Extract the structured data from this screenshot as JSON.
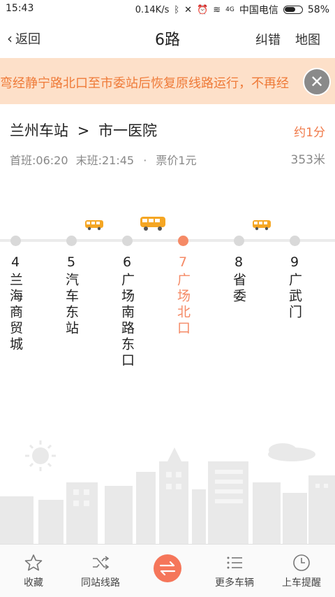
{
  "status_bar": {
    "time": "15:43",
    "speed": "0.14K/s",
    "network_badge": "4G",
    "carrier": "中国电信",
    "battery": "58%"
  },
  "header": {
    "back_label": "返回",
    "title": "6路",
    "correct_label": "纠错",
    "map_label": "地图"
  },
  "notice": {
    "text": "弯经静宁路北口至市委站后恢复原线路运行，不再经"
  },
  "info": {
    "from": "兰州车站",
    "arrow": ">",
    "to": "市一医院",
    "eta": "约1分",
    "first_bus": "首班:06:20",
    "last_bus": "末班:21:45",
    "sep": "·",
    "fare": "票价1元",
    "distance": "353米"
  },
  "stops": [
    {
      "num": "4",
      "name": "兰海商贸城",
      "current": false
    },
    {
      "num": "5",
      "name": "汽车东站",
      "current": false
    },
    {
      "num": "6",
      "name": "广场南路东口",
      "current": false
    },
    {
      "num": "7",
      "name": "广场北口",
      "current": true
    },
    {
      "num": "8",
      "name": "省委",
      "current": false
    },
    {
      "num": "9",
      "name": "广武门",
      "current": false
    }
  ],
  "colors": {
    "accent": "#f58a66",
    "notice_bg": "#fde0c9",
    "notice_text": "#ef7a38",
    "bus": "#f5a623"
  },
  "bottom_nav": {
    "favorite": "收藏",
    "same_stop_lines": "同站线路",
    "more_vehicles": "更多车辆",
    "boarding_reminder": "上车提醒"
  }
}
